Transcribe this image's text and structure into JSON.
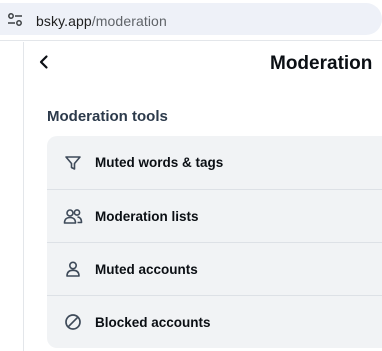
{
  "browser": {
    "url_host": "bsky.app",
    "url_path": "/moderation"
  },
  "header": {
    "title": "Moderation"
  },
  "moderation_tools": {
    "section_title": "Moderation tools",
    "items": [
      {
        "label": "Muted words & tags",
        "icon": "filter-icon"
      },
      {
        "label": "Moderation lists",
        "icon": "people-icon"
      },
      {
        "label": "Muted accounts",
        "icon": "person-icon"
      },
      {
        "label": "Blocked accounts",
        "icon": "block-icon"
      }
    ]
  },
  "colors": {
    "list_background": "#f1f3f5",
    "section_title": "#2c3a4b",
    "urlbar_background": "#eef1f8"
  }
}
